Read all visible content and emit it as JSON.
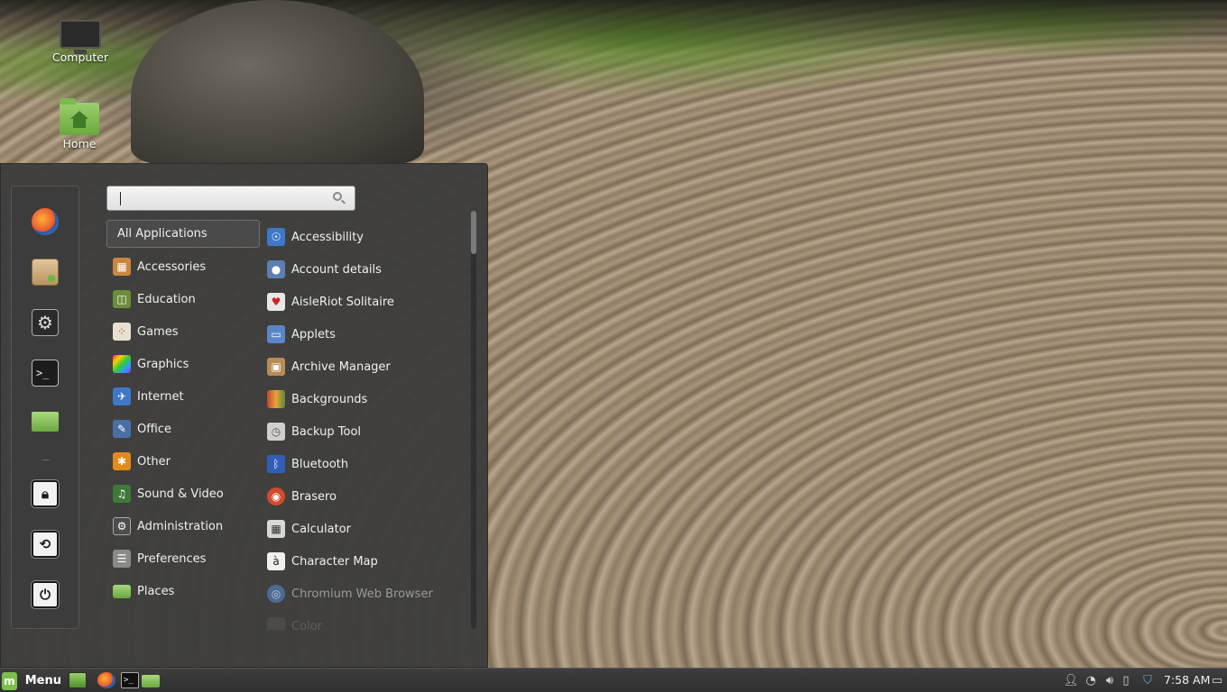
{
  "desktop": {
    "icons": [
      {
        "label": "Computer",
        "icon": "computer-icon"
      },
      {
        "label": "Home",
        "icon": "home-folder-icon"
      }
    ]
  },
  "menu": {
    "search": {
      "value": "",
      "placeholder": ""
    },
    "favorites": [
      {
        "name": "Firefox",
        "icon": "firefox-icon"
      },
      {
        "name": "Software Manager",
        "icon": "package-icon"
      },
      {
        "name": "System Settings",
        "icon": "settings-icon"
      },
      {
        "name": "Terminal",
        "icon": "terminal-icon"
      },
      {
        "name": "Files",
        "icon": "folder-icon"
      }
    ],
    "session": [
      {
        "name": "Lock Screen",
        "icon": "lock-icon"
      },
      {
        "name": "Logout",
        "icon": "logout-icon"
      },
      {
        "name": "Quit",
        "icon": "power-icon"
      }
    ],
    "categories": [
      {
        "label": "All Applications",
        "icon": "",
        "color": ""
      },
      {
        "label": "Accessories",
        "icon": "accessories-icon",
        "color": "#c9873e"
      },
      {
        "label": "Education",
        "icon": "education-icon",
        "color": "#6b8e3a"
      },
      {
        "label": "Games",
        "icon": "games-icon",
        "color": "#e8e0d0"
      },
      {
        "label": "Graphics",
        "icon": "graphics-icon",
        "color": "#d9413b"
      },
      {
        "label": "Internet",
        "icon": "internet-icon",
        "color": "#3f78c9"
      },
      {
        "label": "Office",
        "icon": "office-icon",
        "color": "#4a6fa5"
      },
      {
        "label": "Other",
        "icon": "other-icon",
        "color": "#e38a1e"
      },
      {
        "label": "Sound & Video",
        "icon": "sound-video-icon",
        "color": "#3e7a3a"
      },
      {
        "label": "Administration",
        "icon": "administration-icon",
        "color": "#4c4c4c"
      },
      {
        "label": "Preferences",
        "icon": "preferences-icon",
        "color": "#8a8a8a"
      },
      {
        "label": "Places",
        "icon": "places-icon",
        "color": "#7cba4e"
      }
    ],
    "applications": [
      {
        "label": "Accessibility",
        "icon": "accessibility-icon",
        "color": "#3f78c9"
      },
      {
        "label": "Account details",
        "icon": "account-icon",
        "color": "#5a7fb0"
      },
      {
        "label": "AisleRiot Solitaire",
        "icon": "solitaire-icon",
        "color": "#e8e8e8"
      },
      {
        "label": "Applets",
        "icon": "applets-icon",
        "color": "#5a86c8"
      },
      {
        "label": "Archive Manager",
        "icon": "archive-icon",
        "color": "#b98b55"
      },
      {
        "label": "Backgrounds",
        "icon": "backgrounds-icon",
        "color": "#c0452f"
      },
      {
        "label": "Backup Tool",
        "icon": "backup-icon",
        "color": "#cfcfcf"
      },
      {
        "label": "Bluetooth",
        "icon": "bluetooth-icon",
        "color": "#2f5fb8"
      },
      {
        "label": "Brasero",
        "icon": "brasero-icon",
        "color": "#d34a2a"
      },
      {
        "label": "Calculator",
        "icon": "calculator-icon",
        "color": "#d8d8d8"
      },
      {
        "label": "Character Map",
        "icon": "character-map-icon",
        "color": "#f0f0f0"
      },
      {
        "label": "Chromium Web Browser",
        "icon": "chromium-icon",
        "color": "#4f7fb8"
      },
      {
        "label": "Color",
        "icon": "color-icon",
        "color": "#666"
      }
    ]
  },
  "taskbar": {
    "menu_label": "Menu",
    "launchers": [
      "files-icon",
      "firefox-icon",
      "terminal-icon",
      "folder-icon"
    ],
    "tray": [
      "user-icon",
      "wifi-icon",
      "volume-icon",
      "battery-icon",
      "shield-icon",
      "show-desktop-icon"
    ],
    "clock": "7:58 AM"
  }
}
